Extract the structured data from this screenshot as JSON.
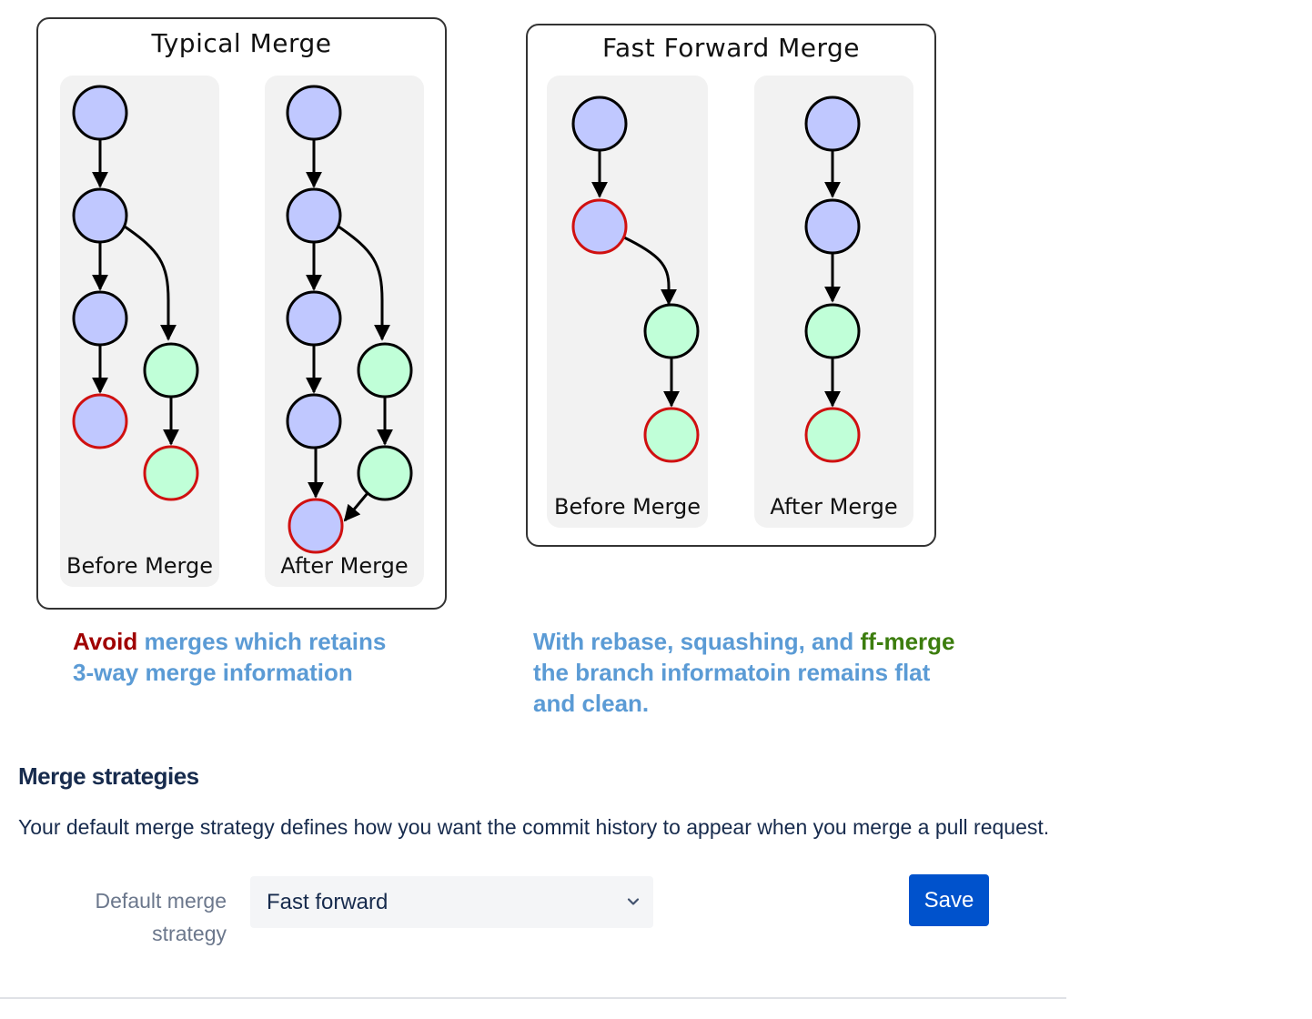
{
  "diagrams": {
    "typical": {
      "title": "Typical Merge",
      "before_label": "Before Merge",
      "after_label": "After Merge"
    },
    "fast_forward": {
      "title": "Fast Forward Merge",
      "before_label": "Before Merge",
      "after_label": "After Merge"
    }
  },
  "captions": {
    "left": {
      "avoid": "Avoid",
      "rest_line1": " merges which retains",
      "line2": "3-way merge information"
    },
    "right": {
      "line1_prefix": "With rebase, squashing, and ",
      "ff": "ff-merge",
      "line2": "the branch informatoin remains flat",
      "line3": "and clean."
    }
  },
  "settings": {
    "section_title": "Merge strategies",
    "description": "Your default merge strategy defines how you want the commit history to appear when you merge a pull request.",
    "field_label_line1": "Default merge",
    "field_label_line2": "strategy",
    "selected_value": "Fast forward",
    "save_label": "Save"
  },
  "colors": {
    "commit_blue": "#c0c8ff",
    "commit_green": "#c0ffd8",
    "head_outline": "#d01010",
    "caption_blue": "#5b9bd5",
    "caption_red": "#a00000",
    "caption_green": "#3c7d0e",
    "primary_button": "#0052cc"
  },
  "icons": {
    "select_chevron": "chevron-down-icon"
  }
}
